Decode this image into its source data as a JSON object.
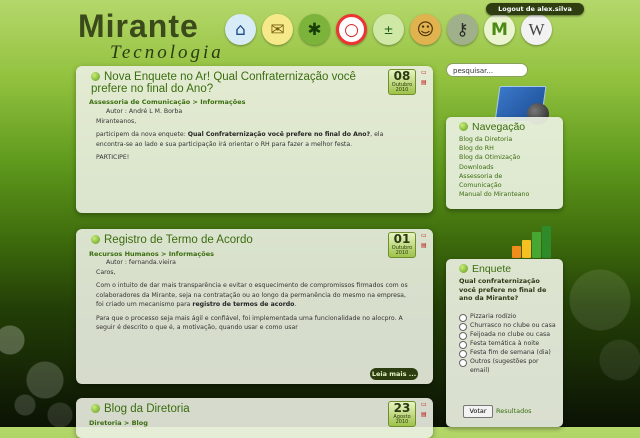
{
  "header": {
    "logo_title": "Mirante",
    "logo_subtitle": "Tecnologia",
    "logout": "Logout de alex.silva",
    "search_value": "pesquisar..."
  },
  "posts": [
    {
      "title": "Nova Enquete no Ar! Qual Confraternização você prefere no final do Ano?",
      "date": {
        "day": "08",
        "month": "Outubro",
        "year": "2010"
      },
      "categories": "Assessoria de Comunicação > Informações",
      "author": "Autor : André L M. Borba",
      "greeting": "Miranteanos,",
      "p1_start": "participem da nova enquete: ",
      "p1_bold": "Qual Confraternização você prefere no final do Ano?",
      "p1_end": ", ela encontra-se ao lado e sua participação irá orientar o RH para fazer a melhor festa.",
      "p2": "PARTICIPE!"
    },
    {
      "title": "Registro de Termo de Acordo",
      "date": {
        "day": "01",
        "month": "Outubro",
        "year": "2010"
      },
      "categories": "Recursos Humanos > Informações",
      "author": "Autor : fernanda.vieira",
      "greeting": "Caros,",
      "p1_start": "Com o intuito de dar mais transparência e evitar o esquecimento de compromissos firmados com os colaboradores da Mirante, seja na contratação ou ao longo da permanência do mesmo na empresa, foi criado um mecanismo para ",
      "p1_bold": "registro de termos de acordo",
      "p1_end": ".",
      "p2": "Para que o processo seja mais ágil e confiável, foi implementada uma funcionalidade no alocpro. A seguir é descrito o que é, a motivação, quando usar e como usar",
      "more": "Leia mais ..."
    },
    {
      "title": "Blog da Diretoria",
      "date": {
        "day": "23",
        "month": "Agosto",
        "year": "2010"
      },
      "categories": "Diretoria > Blog"
    }
  ],
  "navigation": {
    "title": "Navegação",
    "items": [
      "Blog da Diretoria",
      "Blog do RH",
      "Blog da Otimização",
      "Downloads",
      "Assessoria de",
      "Comunicação",
      "Manual do Miranteano"
    ]
  },
  "poll": {
    "title": "Enquete",
    "question": "Qual confraternização você prefere no final de ano da Mirante?",
    "options": [
      "Pizzaria rodízio",
      "Churrasco no clube ou casa",
      "Feijoada no clube ou casa",
      "Festa temática à noite",
      "Festa fim de semana (dia)",
      "Outros (sugestões por email)"
    ],
    "vote_button": "Votar",
    "results_link": "Resultados"
  },
  "icons": [
    "home-icon",
    "mail-icon",
    "bug-icon",
    "lifebuoy-icon",
    "calc-icon",
    "user-icon",
    "keys-icon",
    "mirante-icon",
    "wikipedia-icon"
  ]
}
